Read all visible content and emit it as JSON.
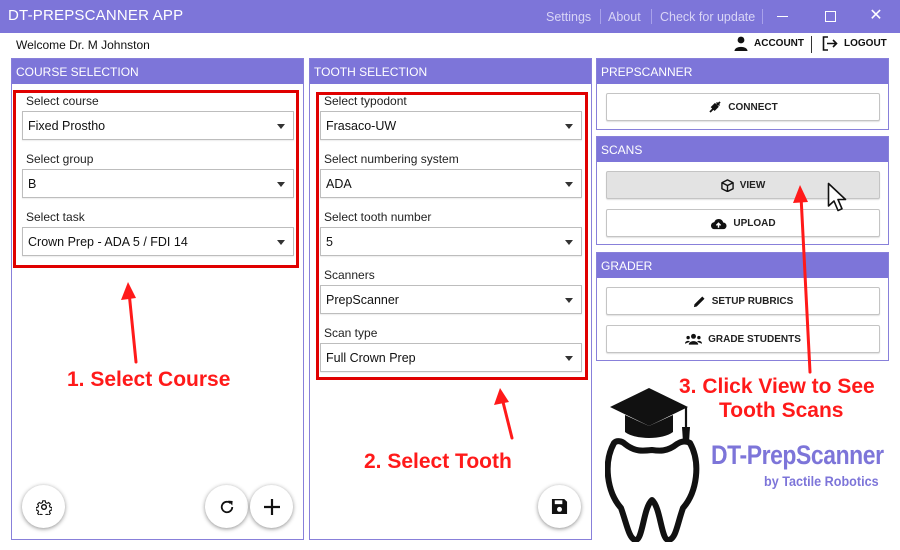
{
  "app": {
    "title": "DT-PREPSCANNER APP"
  },
  "titlebar": {
    "menu": [
      "Settings",
      "About",
      "Check for update"
    ]
  },
  "header": {
    "welcome": "Welcome Dr. M Johnston",
    "account_label": "ACCOUNT",
    "logout_label": "LOGOUT"
  },
  "course_panel": {
    "title": "COURSE SELECTION",
    "fields": [
      {
        "label": "Select course",
        "value": "Fixed Prostho"
      },
      {
        "label": "Select group",
        "value": "B"
      },
      {
        "label": "Select task",
        "value": "Crown Prep - ADA 5 / FDI 14"
      }
    ]
  },
  "tooth_panel": {
    "title": "TOOTH SELECTION",
    "fields": [
      {
        "label": "Select typodont",
        "value": "Frasaco-UW"
      },
      {
        "label": "Select numbering system",
        "value": "ADA"
      },
      {
        "label": "Select tooth number",
        "value": "5"
      },
      {
        "label": "Scanners",
        "value": "PrepScanner"
      },
      {
        "label": "Scan type",
        "value": "Full Crown Prep"
      }
    ]
  },
  "prepscanner_panel": {
    "title": "PREPSCANNER",
    "connect_label": "CONNECT"
  },
  "scans_panel": {
    "title": "SCANS",
    "view_label": "VIEW",
    "upload_label": "UPLOAD"
  },
  "grader_panel": {
    "title": "GRADER",
    "rubrics_label": "SETUP RUBRICS",
    "grade_label": "GRADE STUDENTS"
  },
  "annotations": {
    "step1": "1. Select Course",
    "step2": "2. Select Tooth",
    "step3_line1": "3. Click View to See",
    "step3_line2": "Tooth Scans"
  },
  "logo": {
    "name": "DT-PrepScanner",
    "byline": "by Tactile Robotics"
  },
  "colors": {
    "accent": "#7d75d9",
    "annotation": "#e00000"
  }
}
